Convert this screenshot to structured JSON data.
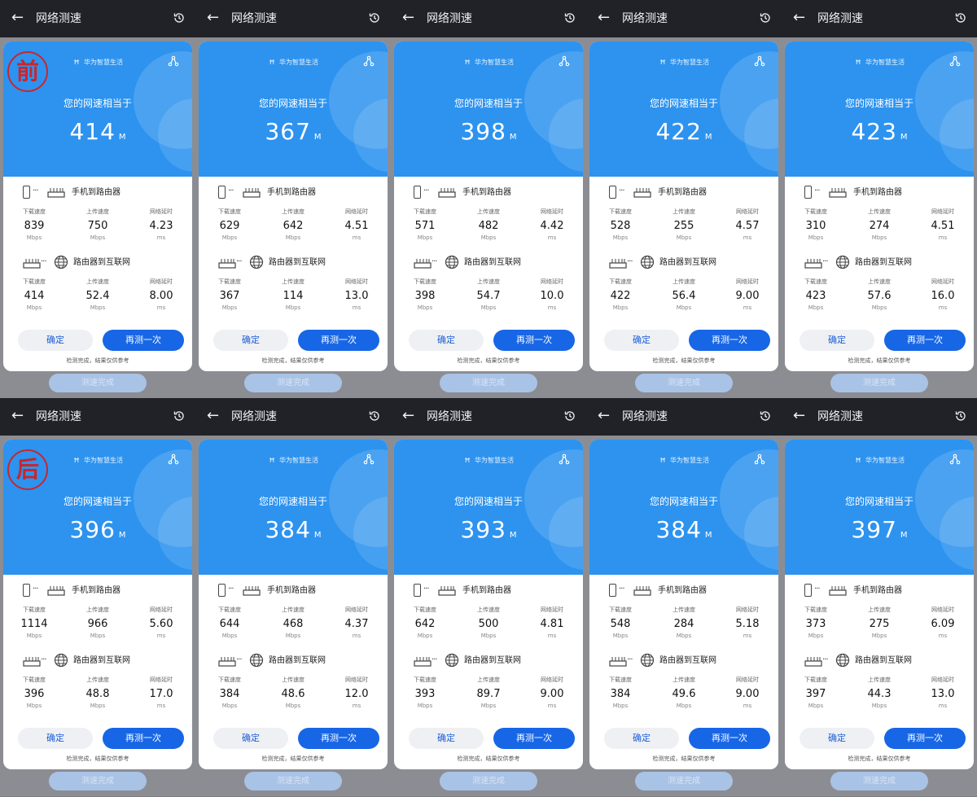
{
  "common": {
    "app_title": "网络测速",
    "brand": "华为智慧生活",
    "headline": "您的网速相当于",
    "speed_unit": "M",
    "section1_label": "手机到路由器",
    "section2_label": "路由器到互联网",
    "col_download": "下载速度",
    "col_upload": "上传速度",
    "col_latency": "网络延时",
    "unit_mbps": "Mbps",
    "unit_ms": "ms",
    "btn_ok": "确定",
    "btn_retest": "再测一次",
    "note": "检测完成，结果仅供参考",
    "done_label": "测速完成",
    "back_glyph": "←",
    "dots": "···"
  },
  "stamps": {
    "before": "前",
    "after": "后"
  },
  "panels": [
    {
      "speed": "414",
      "s1": {
        "down": "839",
        "up": "750",
        "lat": "4.23"
      },
      "s2": {
        "down": "414",
        "up": "52.4",
        "lat": "8.00"
      }
    },
    {
      "speed": "367",
      "s1": {
        "down": "629",
        "up": "642",
        "lat": "4.51"
      },
      "s2": {
        "down": "367",
        "up": "114",
        "lat": "13.0"
      }
    },
    {
      "speed": "398",
      "s1": {
        "down": "571",
        "up": "482",
        "lat": "4.42"
      },
      "s2": {
        "down": "398",
        "up": "54.7",
        "lat": "10.0"
      }
    },
    {
      "speed": "422",
      "s1": {
        "down": "528",
        "up": "255",
        "lat": "4.57"
      },
      "s2": {
        "down": "422",
        "up": "56.4",
        "lat": "9.00"
      }
    },
    {
      "speed": "423",
      "s1": {
        "down": "310",
        "up": "274",
        "lat": "4.51"
      },
      "s2": {
        "down": "423",
        "up": "57.6",
        "lat": "16.0"
      }
    },
    {
      "speed": "396",
      "s1": {
        "down": "1114",
        "up": "966",
        "lat": "5.60"
      },
      "s2": {
        "down": "396",
        "up": "48.8",
        "lat": "17.0"
      }
    },
    {
      "speed": "384",
      "s1": {
        "down": "644",
        "up": "468",
        "lat": "4.37"
      },
      "s2": {
        "down": "384",
        "up": "48.6",
        "lat": "12.0"
      }
    },
    {
      "speed": "393",
      "s1": {
        "down": "642",
        "up": "500",
        "lat": "4.81"
      },
      "s2": {
        "down": "393",
        "up": "89.7",
        "lat": "9.00"
      }
    },
    {
      "speed": "384",
      "s1": {
        "down": "548",
        "up": "284",
        "lat": "5.18"
      },
      "s2": {
        "down": "384",
        "up": "49.6",
        "lat": "9.00"
      }
    },
    {
      "speed": "397",
      "s1": {
        "down": "373",
        "up": "275",
        "lat": "6.09"
      },
      "s2": {
        "down": "397",
        "up": "44.3",
        "lat": "13.0"
      }
    }
  ],
  "colors": {
    "hero_blue": "#2d93ef",
    "primary_button": "#1766e6",
    "stamp_red": "#c9262b",
    "appbar_dark": "#202227"
  }
}
